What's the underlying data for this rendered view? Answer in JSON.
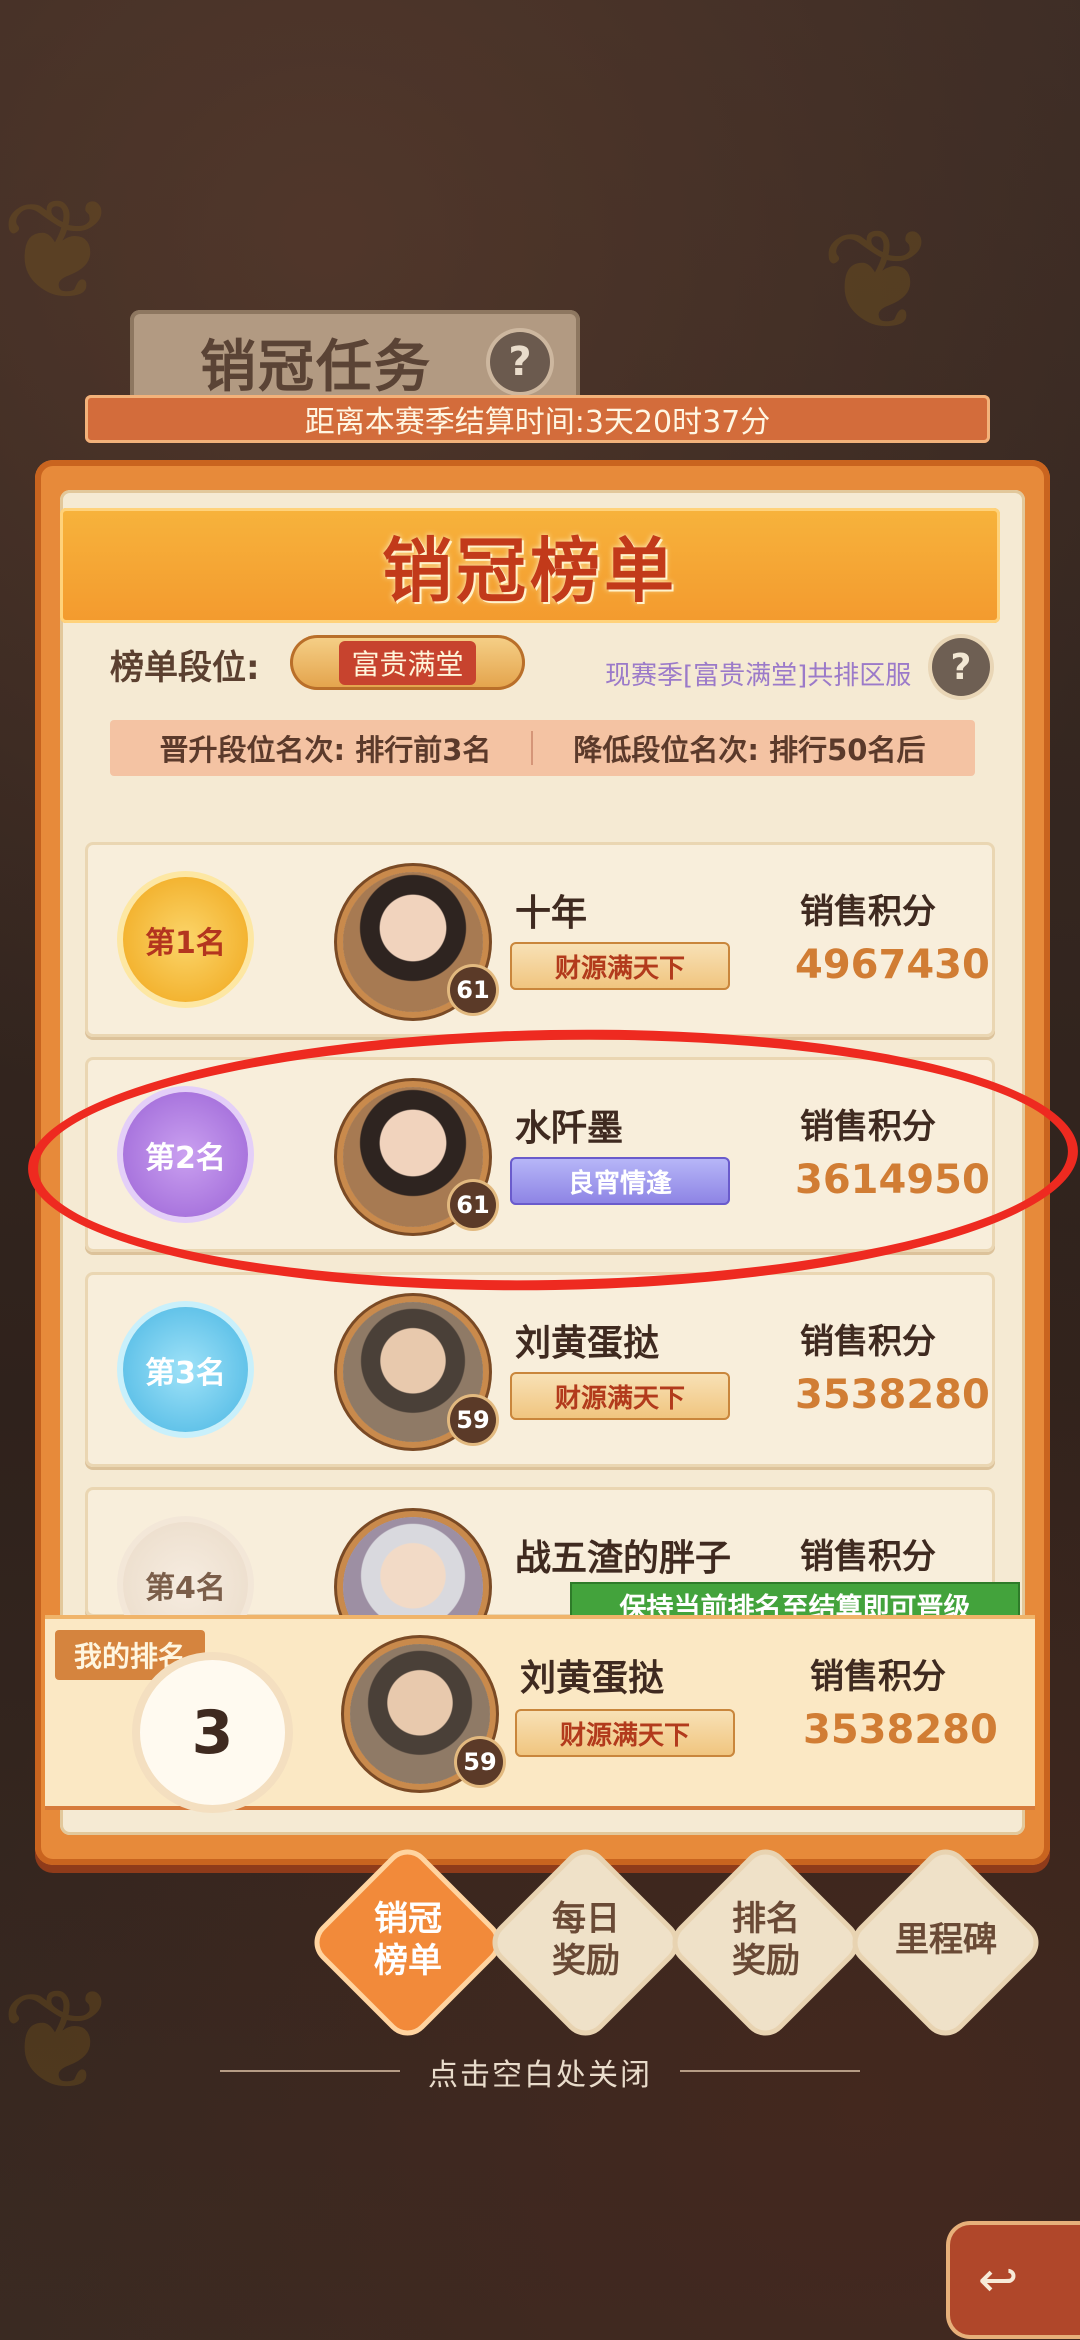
{
  "header": {
    "plaque_title": "销冠任务",
    "help_glyph": "?",
    "season_countdown": "距离本赛季结算时间:3天20时37分"
  },
  "board": {
    "title": "销冠榜单",
    "tier_label": "榜单段位:",
    "tier_name": "富贵满堂",
    "season_server": "现赛季[富贵满堂]共排区服",
    "promotion": "晋升段位名次: 排行前3名",
    "demotion": "降低段位名次: 排行50名后"
  },
  "ranks": [
    {
      "rank_label": "第1名",
      "name": "十年",
      "level": "61",
      "title": "财源满天下",
      "score_label": "销售积分",
      "score": "4967430"
    },
    {
      "rank_label": "第2名",
      "name": "水阡墨",
      "level": "61",
      "title": "良宵情逢",
      "score_label": "销售积分",
      "score": "3614950"
    },
    {
      "rank_label": "第3名",
      "name": "刘黄蛋挞",
      "level": "59",
      "title": "财源满天下",
      "score_label": "销售积分",
      "score": "3538280"
    },
    {
      "rank_label": "第4名",
      "name": "战五渣的胖子",
      "level": "",
      "title": "",
      "score_label": "销售积分",
      "score": ""
    }
  ],
  "promote_hint": "保持当前排名至结算即可晋级",
  "my_rank": {
    "tab_label": "我的排名",
    "rank": "3",
    "name": "刘黄蛋挞",
    "level": "59",
    "title": "财源满天下",
    "score_label": "销售积分",
    "score": "3538280"
  },
  "tabs": [
    {
      "label": "销冠\n榜单",
      "active": true
    },
    {
      "label": "每日\n奖励",
      "active": false
    },
    {
      "label": "排名\n奖励",
      "active": false
    },
    {
      "label": "里程碑",
      "active": false
    }
  ],
  "close_hint": "点击空白处关闭",
  "colors": {
    "accent": "#e78a3a",
    "score": "#d17d34",
    "highlight_circle": "#ee2a20",
    "promote_green": "#43a33c"
  }
}
